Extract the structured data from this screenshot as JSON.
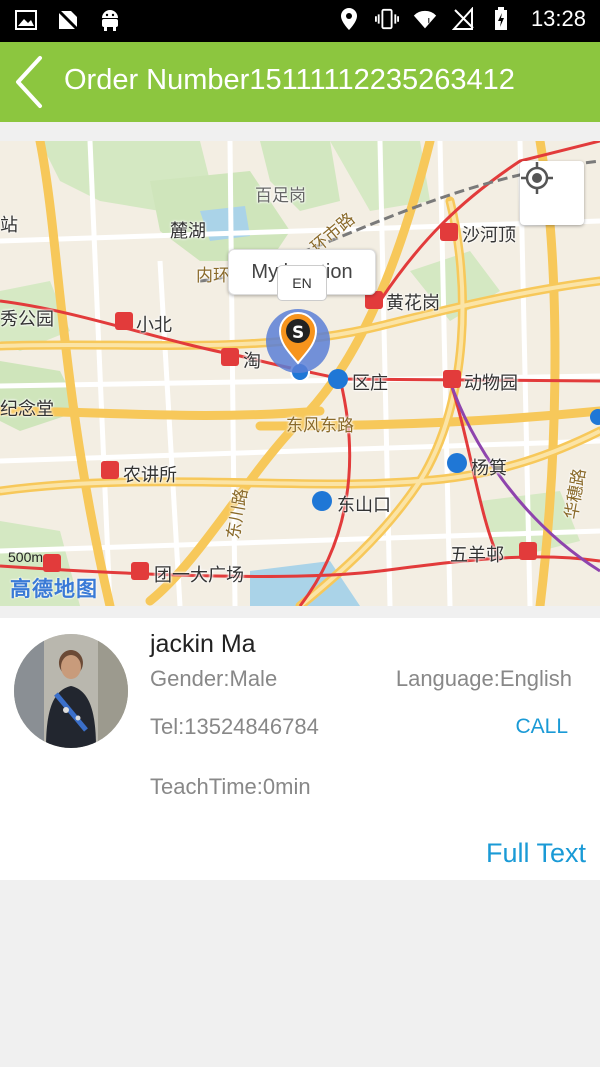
{
  "status_bar": {
    "time": "13:28",
    "left_icons": [
      "image-icon",
      "no-sim-icon",
      "android-icon"
    ],
    "right_icons": [
      "location-pin-icon",
      "vibrate-icon",
      "wifi-icon",
      "no-signal-icon",
      "battery-icon"
    ]
  },
  "header": {
    "title": "Order Number15111112235263412",
    "back_icon": "chevron-left-icon",
    "background": "#8cc63f"
  },
  "map": {
    "bubble_text": "My location",
    "marker_tag": "EN",
    "marker_letter": "S",
    "scale": "500m",
    "logo": "高德地图",
    "labels": {
      "station": "站",
      "baizugang": "百足岗",
      "luhu": "麓湖",
      "shahedding": "沙河顶",
      "neihuan": "内环",
      "huanghuagang": "黄花岗",
      "xiugongyuan": "秀公园",
      "xiaobei": "小北",
      "tao": "淘",
      "quzhuang": "区庄",
      "dongwuyuan": "动物园",
      "jiniantang": "纪念堂",
      "dongfengdonglu": "东风东路",
      "nongjiangsuo": "农讲所",
      "yangji": "杨箕",
      "dongchuanlu": "东川路",
      "dongshankou": "东山口",
      "huasuilu": "华穗路",
      "wuyanggong": "五羊邨",
      "tuanyidaguangchang": "团一大广场",
      "huanshilu": "环市路"
    },
    "accent_marker": "#f7941d",
    "accent_dot": "#1f77d6"
  },
  "profile": {
    "name": "jackin Ma",
    "gender": "Gender:Male",
    "language": "Language:English",
    "tel": "Tel:13524846784",
    "call_label": "CALL",
    "teach_time": "TeachTime:0min",
    "full_text_label": "Full Text",
    "link_color": "#1a9ad6"
  }
}
